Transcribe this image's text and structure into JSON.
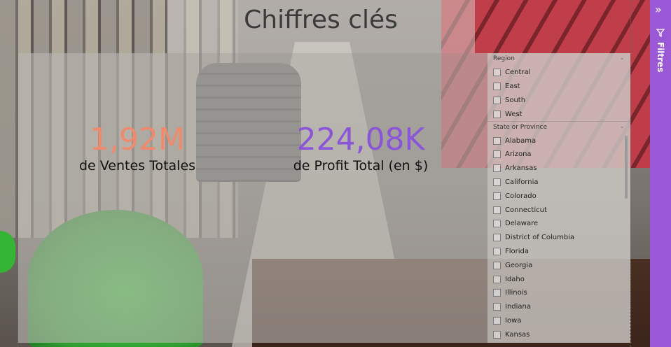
{
  "page": {
    "title": "Chiffres clés"
  },
  "kpis": {
    "sales": {
      "value": "1,92M",
      "label": "de Ventes Totales",
      "color": "#f08a6c"
    },
    "profit": {
      "value": "224,08K",
      "label": "de Profit Total (en $)",
      "color": "#8a55d6"
    }
  },
  "slicer": {
    "region": {
      "header": "Region",
      "items": [
        "Central",
        "East",
        "South",
        "West"
      ]
    },
    "state": {
      "header": "State or Province",
      "items": [
        "Alabama",
        "Arizona",
        "Arkansas",
        "California",
        "Colorado",
        "Connecticut",
        "Delaware",
        "District of Columbia",
        "Florida",
        "Georgia",
        "Idaho",
        "Illinois",
        "Indiana",
        "Iowa",
        "Kansas"
      ]
    }
  },
  "filters_pane": {
    "label": "Filtres",
    "color": "#9a57d6",
    "collapse_icon": "double-chevron-right-icon",
    "filter_icon": "funnel-icon"
  }
}
